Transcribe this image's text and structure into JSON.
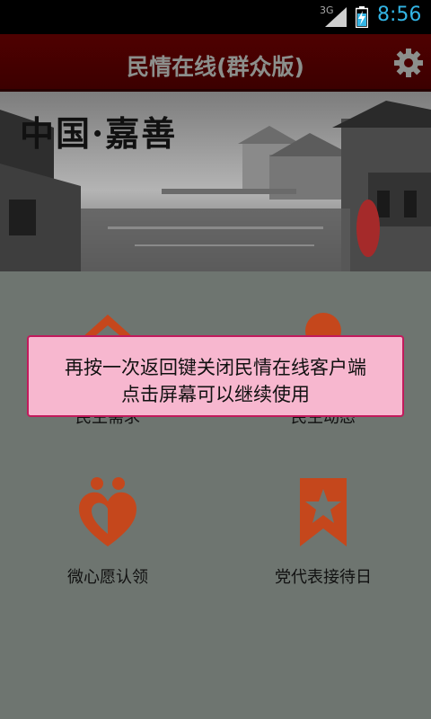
{
  "status_bar": {
    "network": "3G",
    "time": "8:56",
    "accent": "#33b5e5"
  },
  "header": {
    "title": "民情在线(群众版)",
    "settings_icon": "gear-icon",
    "background": "#4a0000"
  },
  "banner": {
    "calligraphy": "中国·嘉善",
    "seal": "地善人嘉"
  },
  "tiles": [
    {
      "label": "民生需求",
      "icon": "house-icon"
    },
    {
      "label": "民生动态",
      "icon": "person-icon"
    },
    {
      "label": "微心愿认领",
      "icon": "heart-people-icon"
    },
    {
      "label": "党代表接待日",
      "icon": "bookmark-star-icon"
    }
  ],
  "toast": {
    "line1": "再按一次返回键关闭民情在线客户端",
    "line2": "点击屏幕可以继续使用"
  },
  "colors": {
    "icon": "#c5471c",
    "toast_bg": "#f7b7cf",
    "toast_border": "#c21a5c"
  }
}
